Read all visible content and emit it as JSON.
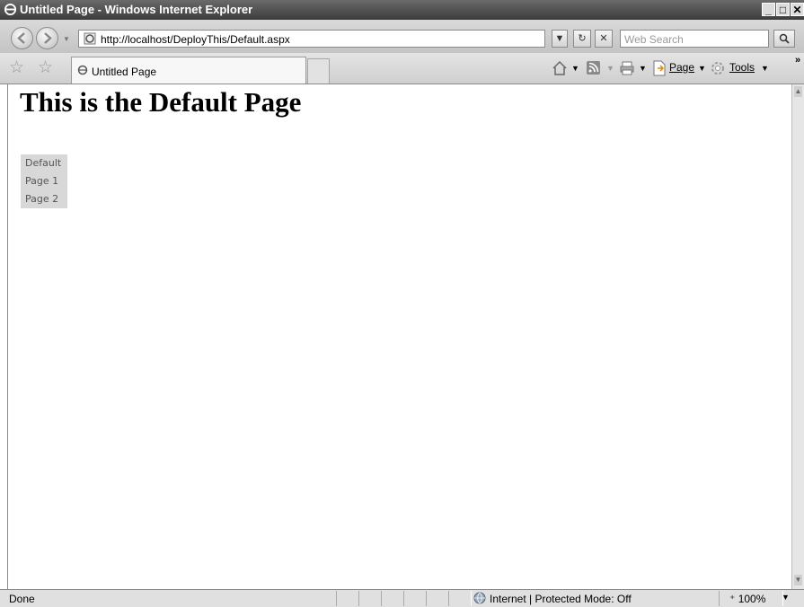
{
  "window": {
    "title": "Untitled Page - Windows Internet Explorer",
    "minimize": "_",
    "maximize": "□",
    "close": "✕"
  },
  "address_bar": {
    "url": "http://localhost/DeployThis/Default.aspx",
    "search_placeholder": "Web Search"
  },
  "tab": {
    "label": "Untitled Page"
  },
  "command_bar": {
    "page_label": "Page",
    "tools_label": "Tools"
  },
  "page": {
    "heading": "This is the Default Page",
    "menu_items": [
      "Default",
      "Page 1",
      "Page 2"
    ]
  },
  "status_bar": {
    "status": "Done",
    "zone": "Internet | Protected Mode: Off",
    "zoom": "100%"
  }
}
